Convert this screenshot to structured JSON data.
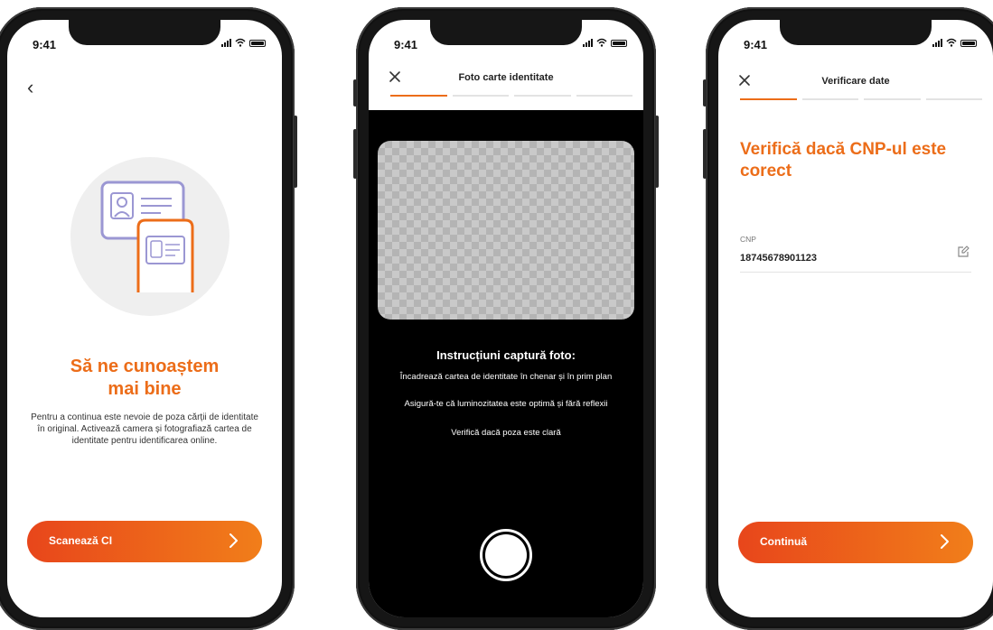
{
  "status_time": "9:41",
  "screen1": {
    "title_line1": "Să ne cunoaștem",
    "title_line2": "mai bine",
    "description": "Pentru a continua este nevoie de poza cărții de identitate în original. Activează camera și fotografiază cartea de identitate pentru identificarea online.",
    "cta_label": "Scanează CI"
  },
  "screen2": {
    "header_title": "Foto carte identitate",
    "instructions_title": "Instrucțiuni captură foto:",
    "instruction_1": "Încadrează cartea de identitate în chenar și în prim plan",
    "instruction_2": "Asigură-te că luminozitatea este optimă și fără reflexii",
    "instruction_3": "Verifică dacă poza este clară"
  },
  "screen3": {
    "header_title": "Verificare date",
    "title": "Verifică dacă CNP-ul este corect",
    "cnp_label": "CNP",
    "cnp_value": "18745678901123",
    "cta_label": "Continuă"
  },
  "colors": {
    "accent": "#ec6d19",
    "gradient_start": "#e8461b",
    "gradient_end": "#f17e1a",
    "illustration_purple": "#9b97d3"
  }
}
